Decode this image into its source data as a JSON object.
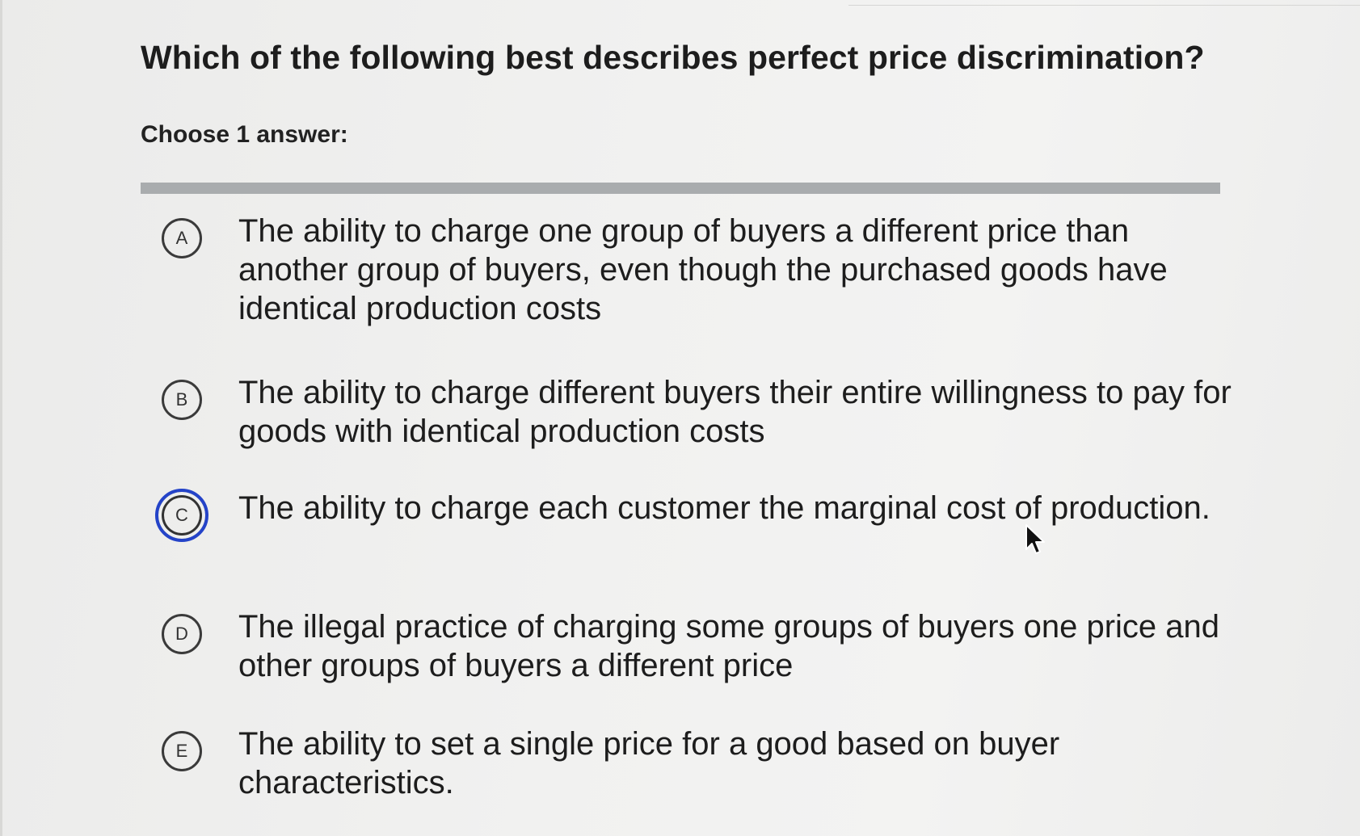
{
  "question": {
    "title": "Which of the following best describes perfect price discrimination?",
    "instruction": "Choose 1 answer:"
  },
  "choices": [
    {
      "letter": "A",
      "text": "The ability to charge one group of buyers a different price than another group of buyers, even though the purchased goods have identical production costs",
      "selected": false
    },
    {
      "letter": "B",
      "text": "The ability to charge different buyers their entire willingness to pay for goods with identical production costs",
      "selected": false
    },
    {
      "letter": "C",
      "text": "The ability to charge each customer the marginal cost of production.",
      "selected": true
    },
    {
      "letter": "D",
      "text": "The illegal practice of charging some groups of buyers one price and other groups of buyers a different price",
      "selected": false
    },
    {
      "letter": "E",
      "text": "The ability to set a single price for a good based on buyer characteristics.",
      "selected": false
    }
  ],
  "colors": {
    "selected_ring": "#2443c8",
    "divider": "#a9acae",
    "background": "#eeeeec"
  },
  "icons": {
    "cursor": "mouse-pointer-icon"
  }
}
